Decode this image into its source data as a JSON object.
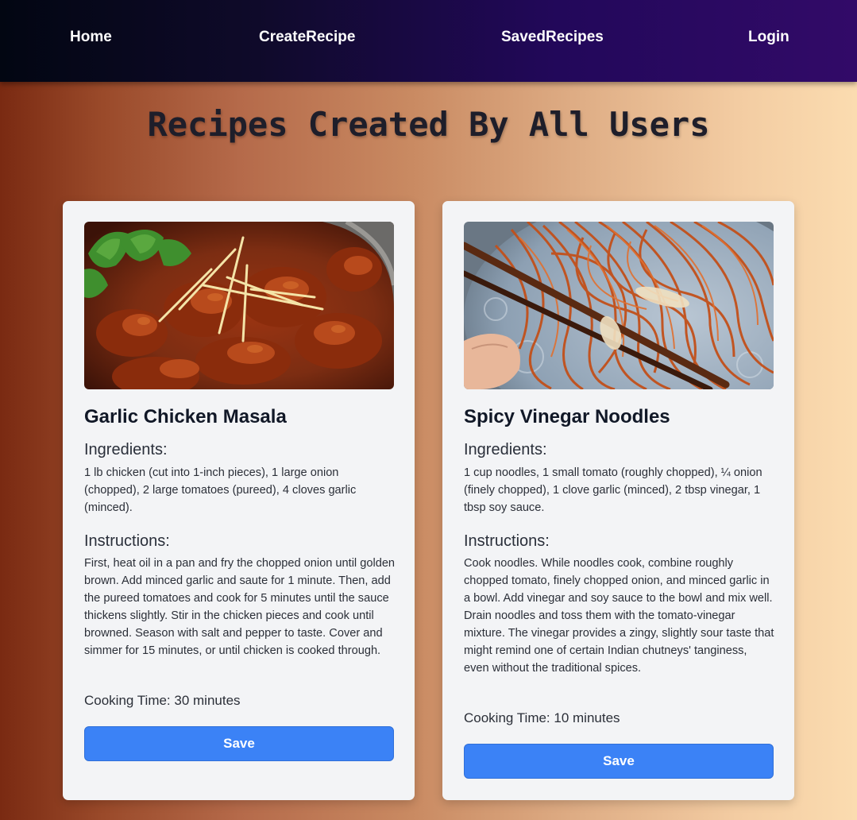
{
  "nav": {
    "home": "Home",
    "create": "CreateRecipe",
    "saved": "SavedRecipes",
    "login": "Login"
  },
  "page": {
    "title": "Recipes Created By All Users"
  },
  "recipes": [
    {
      "name": "Garlic Chicken Masala",
      "image": "chicken-masala-photo",
      "ingredients_label": "Ingredients:",
      "ingredients": "1 lb chicken (cut into 1-inch pieces), 1 large onion (chopped), 2 large tomatoes (pureed), 4 cloves garlic (minced).",
      "instructions_label": "Instructions:",
      "instructions": "First, heat oil in a pan and fry the chopped onion until golden brown. Add minced garlic and saute for 1 minute. Then, add the pureed tomatoes and cook for 5 minutes until the sauce thickens slightly. Stir in the chicken pieces and cook until browned. Season with salt and pepper to taste. Cover and simmer for 15 minutes, or until chicken is cooked through.",
      "cooking_time": "Cooking Time: 30 minutes",
      "save_label": "Save"
    },
    {
      "name": "Spicy Vinegar Noodles",
      "image": "vinegar-noodles-photo",
      "ingredients_label": "Ingredients:",
      "ingredients": "1 cup noodles, 1 small tomato (roughly chopped), ¼ onion (finely chopped), 1 clove garlic (minced), 2 tbsp vinegar, 1 tbsp soy sauce.",
      "instructions_label": "Instructions:",
      "instructions": "Cook noodles. While noodles cook, combine roughly chopped tomato, finely chopped onion, and minced garlic in a bowl. Add vinegar and soy sauce to the bowl and mix well. Drain noodles and toss them with the tomato-vinegar mixture. The vinegar provides a zingy, slightly sour taste that might remind one of certain Indian chutneys' tanginess, even without the traditional spices.",
      "cooking_time": "Cooking Time: 10 minutes",
      "save_label": "Save"
    }
  ],
  "colors": {
    "accent": "#3b82f6",
    "nav_start": "#020612",
    "nav_end": "#320a68",
    "card_bg": "#f3f4f6"
  }
}
